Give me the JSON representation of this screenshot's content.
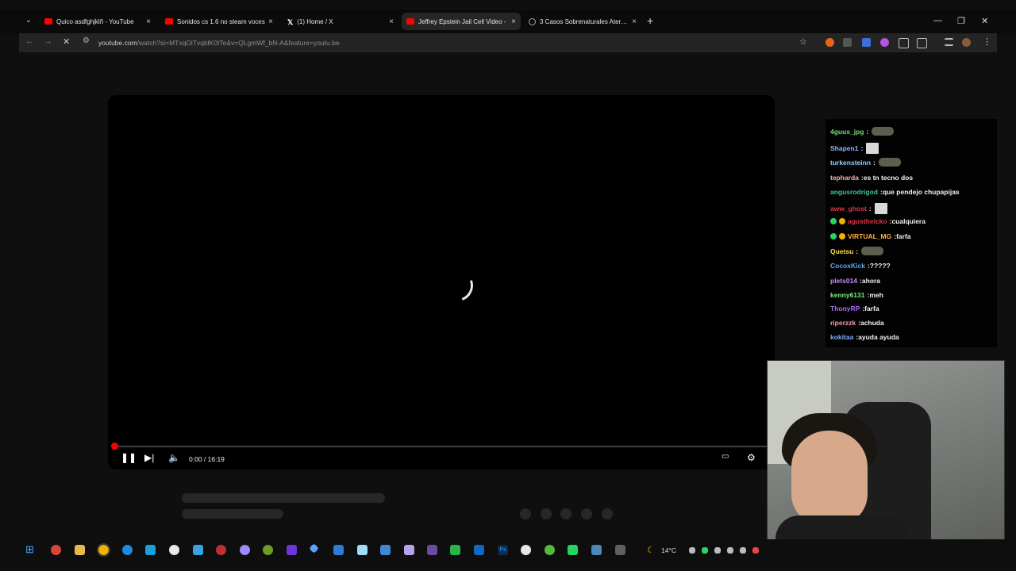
{
  "browser": {
    "tabs": [
      {
        "title": "Quico asdfghjklñ - YouTube",
        "icon": "youtube-icon",
        "active": false
      },
      {
        "title": "Sonidos cs 1.6 no steam voces",
        "icon": "youtube-icon",
        "active": false
      },
      {
        "title": "(1) Home / X",
        "icon": "x-icon",
        "active": false
      },
      {
        "title": "Jeffrey Epstein Jail Cell Video -",
        "icon": "youtube-icon",
        "active": true
      },
      {
        "title": "3 Casos Sobrenaturales Aterrad",
        "icon": "globe-icon",
        "active": false
      }
    ],
    "close_glyph": "×",
    "new_tab_glyph": "+",
    "url_host": "youtube.com",
    "url_path": "/watch?si=MTxqOiTvqldK0tTe&v=QLgmWf_bN-A&feature=youtu.be"
  },
  "player": {
    "time": "0:00 / 16:19",
    "progress": 0.0
  },
  "chat": {
    "messages": [
      {
        "user": "4guus_jpg",
        "color": "#6fe07a",
        "text": "",
        "emote": "turtle"
      },
      {
        "user": "Shapen1",
        "color": "#8fb6ff",
        "text": "",
        "emote": "face"
      },
      {
        "user": "turkensteinn",
        "color": "#8fd0ff",
        "text": "",
        "emote": "turtle"
      },
      {
        "user": "tepharda",
        "color": "#ffb0b0",
        "text": "es tn tecno dos",
        "emote": ""
      },
      {
        "user": "angusrodrigod",
        "color": "#3cc6a0",
        "text": "que pendejo chupapijas",
        "emote": ""
      },
      {
        "user": "aww_ghost",
        "color": "#e0334a",
        "text": "",
        "emote": "face"
      },
      {
        "user": "agusthelcko",
        "color": "#e0334a",
        "text": "cualquiera",
        "emote": "",
        "badges": true
      },
      {
        "user": "VIRTUAL_MG",
        "color": "#ffb040",
        "text": "farfa",
        "emote": "",
        "badges": true
      },
      {
        "user": "Quetsu",
        "color": "#ffe04a",
        "text": "",
        "emote": "turtle"
      },
      {
        "user": "CocoxKick",
        "color": "#5aa9ff",
        "text": "?????",
        "emote": ""
      },
      {
        "user": "plets014",
        "color": "#c38cff",
        "text": "ahora",
        "emote": ""
      },
      {
        "user": "kenny6131",
        "color": "#7cf07c",
        "text": "meh",
        "emote": ""
      },
      {
        "user": "ThonyRP",
        "color": "#b06cff",
        "text": "farfa",
        "emote": ""
      },
      {
        "user": "riperzzk",
        "color": "#ff9db0",
        "text": "achuda",
        "emote": ""
      },
      {
        "user": "kokitaa",
        "color": "#7fb0ff",
        "text": "ayuda ayuda",
        "emote": ""
      }
    ],
    "separator": " : "
  },
  "taskbar": {
    "weather": "14°C"
  },
  "colors": {
    "accent_red": "#ff0000",
    "page_bg": "#0f0f0f"
  }
}
